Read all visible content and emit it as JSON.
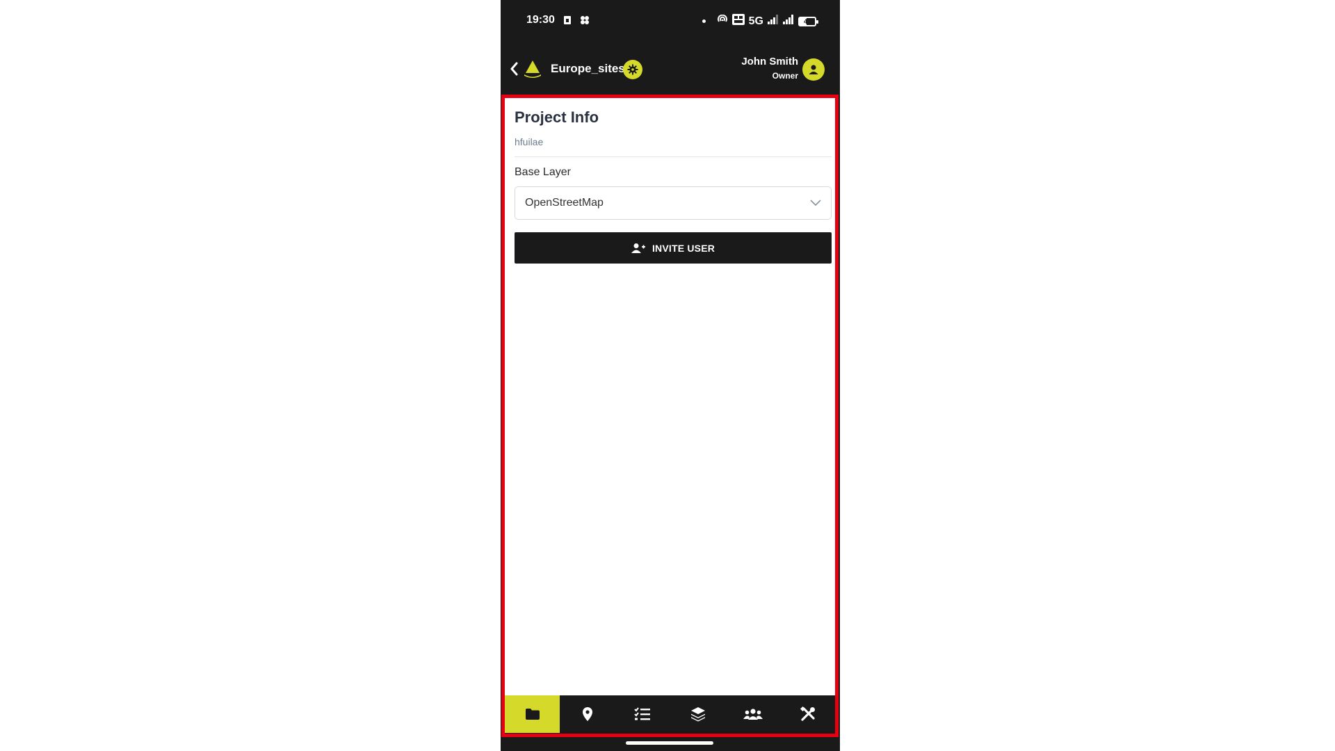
{
  "status_bar": {
    "time": "19:30",
    "network": "5G",
    "battery_level": "47",
    "battery_fraction": 0.47
  },
  "header": {
    "project_name": "Europe_sites",
    "user_name": "John Smith",
    "user_role": "Owner"
  },
  "project_info": {
    "title": "Project Info",
    "description": "hfuilae"
  },
  "base_layer": {
    "label": "Base Layer",
    "selected": "OpenStreetMap"
  },
  "invite_button": {
    "label": "INVITE USER"
  },
  "bottom_nav": {
    "items": [
      "folder-icon",
      "map-pin-icon",
      "checklist-icon",
      "layers-icon",
      "users-icon",
      "tools-icon"
    ],
    "active_index": 0
  },
  "colors": {
    "accent": "#d4d92a",
    "dark": "#1a1a1a",
    "highlight": "#e60012"
  }
}
